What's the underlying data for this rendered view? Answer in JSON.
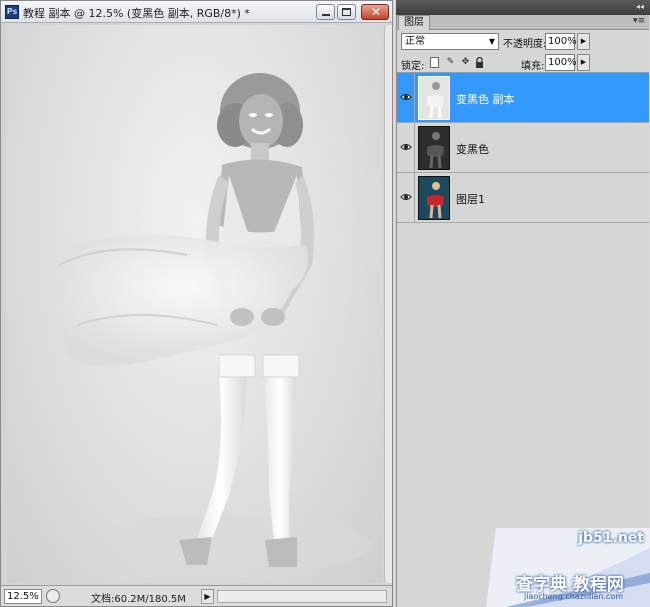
{
  "document": {
    "app_icon_label": "Ps",
    "title": "教程 副本 @ 12.5% (变黑色 副本, RGB/8*) *",
    "zoom": "12.5%",
    "doc_info": "文档:60.2M/180.5M",
    "status_arrow": "▶"
  },
  "layers_panel": {
    "tab_label": "图层",
    "panel_menu_icon": "▾≡",
    "blend_mode": "正常",
    "opacity_label": "不透明度:",
    "opacity_value": "100%",
    "lock_label": "锁定:",
    "fill_label": "填充:",
    "fill_value": "100%",
    "layers": [
      {
        "name": "变黑色 副本",
        "selected": true,
        "visible": true
      },
      {
        "name": "变黑色",
        "selected": false,
        "visible": true
      },
      {
        "name": "图层1",
        "selected": false,
        "visible": true
      }
    ]
  },
  "watermark": {
    "site": "jb51.net",
    "main": "查字典 教程网",
    "url": "jiaocheng.chazidian.com"
  },
  "icons": {
    "close": "close-icon",
    "minimize": "minimize-icon",
    "maximize": "maximize-icon",
    "eye": "eye-icon",
    "lock_all": "lock-icon",
    "move": "move-icon",
    "brush": "brush-icon"
  },
  "colors": {
    "selection": "#3399ff",
    "panel": "#d6d6d6",
    "close_button": "#c4432d"
  }
}
